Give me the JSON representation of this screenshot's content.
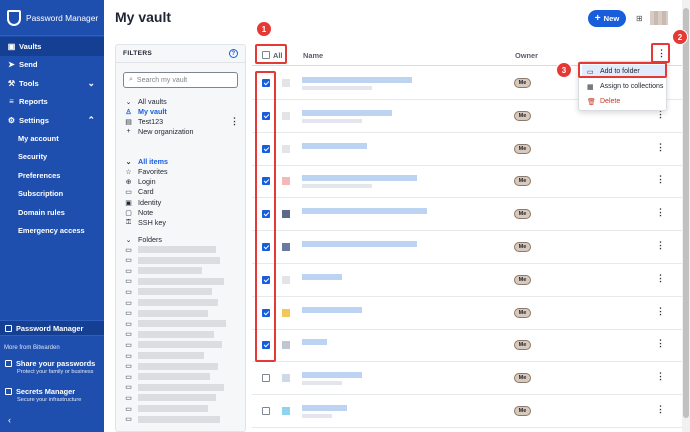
{
  "app": {
    "title": "Password Manager"
  },
  "sidebar": {
    "items": [
      {
        "label": "Vaults",
        "icon": "vault-icon",
        "active": true
      },
      {
        "label": "Send",
        "icon": "send-icon"
      },
      {
        "label": "Tools",
        "icon": "wrench-icon",
        "chevron": "down"
      },
      {
        "label": "Reports",
        "icon": "reports-icon"
      },
      {
        "label": "Settings",
        "icon": "gear-icon",
        "chevron": "up"
      }
    ],
    "settings_sub": [
      "My account",
      "Security",
      "Preferences",
      "Subscription",
      "Domain rules",
      "Emergency access"
    ],
    "product": "Password Manager",
    "more_from": "More from Bitwarden",
    "promos": [
      {
        "title": "Share your passwords",
        "subtitle": "Protect your family or business"
      },
      {
        "title": "Secrets Manager",
        "subtitle": "Secure your infrastructure"
      }
    ],
    "collapse_glyph": "‹"
  },
  "header": {
    "title": "My vault",
    "new_label": "New",
    "new_glyph": "+"
  },
  "filters": {
    "heading": "FILTERS",
    "help_glyph": "?",
    "search_placeholder": "Search my vault",
    "vaults": [
      "All vaults",
      "My vault",
      "Test123",
      "New organization"
    ],
    "types": [
      "All items",
      "Favorites",
      "Login",
      "Card",
      "Identity",
      "Note",
      "SSH key"
    ],
    "folders_label": "Folders"
  },
  "table": {
    "all_label": "All",
    "col_name": "Name",
    "col_owner": "Owner",
    "owner_badge": "Me",
    "rows_checked": [
      true,
      true,
      true,
      true,
      true,
      true,
      true,
      true,
      true,
      false,
      false
    ]
  },
  "menu": {
    "items": [
      {
        "label": "Add to folder",
        "icon": "folder-icon"
      },
      {
        "label": "Assign to collections",
        "icon": "collection-icon"
      },
      {
        "label": "Delete",
        "icon": "trash-icon"
      }
    ]
  },
  "annotations": [
    "1",
    "2",
    "3"
  ],
  "colors": {
    "sidebar": "#1e4fae",
    "accent": "#175ddc",
    "annotation": "#e53935",
    "danger": "#c83522"
  }
}
